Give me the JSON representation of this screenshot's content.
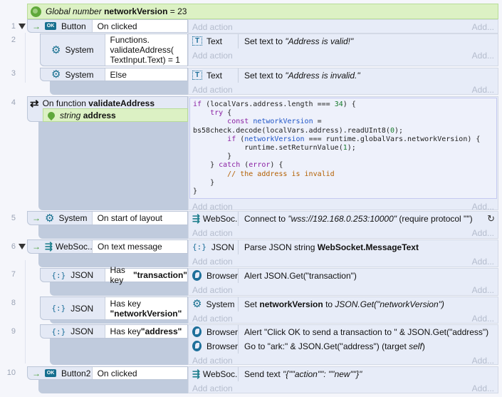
{
  "global_var": {
    "type_label": "Global number",
    "name": "networkVersion",
    "value_text": "= 23"
  },
  "common": {
    "add_action": "Add action",
    "add_more": "Add..."
  },
  "events": [
    {
      "line": "1",
      "object": "Button",
      "condition": "On clicked",
      "actions": []
    },
    {
      "line": "2",
      "object": "System",
      "condition": "Functions. validateAddress( TextInput.Text) = 1",
      "actions": [
        {
          "object": "Text",
          "text_pre": "Set text to ",
          "text_italic": "\"Address is valid!\""
        }
      ]
    },
    {
      "line": "3",
      "object": "System",
      "condition": "Else",
      "actions": [
        {
          "object": "Text",
          "text_pre": "Set text to ",
          "text_italic": "\"Address is invalid.\""
        }
      ]
    },
    {
      "line": "4",
      "function_label": "On function",
      "function_name": "validateAddress",
      "param_type": "string",
      "param_name": "address",
      "code": [
        "if (localVars.address.length === 34) {",
        "    try {",
        "        const networkVersion =",
        "bs58check.decode(localVars.address).readUInt8(0);",
        "        if (networkVersion === runtime.globalVars.networkVersion) {",
        "            runtime.setReturnValue(1);",
        "        }",
        "    } catch (error) {",
        "        // the address is invalid",
        "    }",
        "}"
      ]
    },
    {
      "line": "5",
      "object": "System",
      "condition": "On start of layout",
      "actions": [
        {
          "object": "WebSoc...",
          "text_pre": "Connect to ",
          "text_italic": "\"wss://192.168.0.253:10000\"",
          "text_post": " (require protocol \"\")"
        }
      ]
    },
    {
      "line": "6",
      "object": "WebSoc...",
      "condition": "On text message",
      "actions": [
        {
          "object": "JSON",
          "text_pre": "Parse JSON string ",
          "text_bold": "WebSocket.MessageText"
        }
      ]
    },
    {
      "line": "7",
      "object": "JSON",
      "condition_pre": "Has key ",
      "condition_bold": "\"transaction\"",
      "actions": [
        {
          "object": "Browser",
          "text_pre": "Alert JSON.Get(\"transaction\")"
        }
      ]
    },
    {
      "line": "8",
      "object": "JSON",
      "condition_pre": "Has key",
      "condition_bold": "\"networkVersion\"",
      "actions": [
        {
          "object": "System",
          "text_pre": "Set ",
          "text_bold": "networkVersion",
          "text_mid": " to ",
          "text_italic": "JSON.Get(\"networkVersion\")"
        }
      ]
    },
    {
      "line": "9",
      "object": "JSON",
      "condition_pre": "Has key ",
      "condition_bold": "\"address\"",
      "actions": [
        {
          "object": "Browser",
          "text_pre": "Alert \"Click OK to send a transaction to \" & JSON.Get(\"address\")"
        },
        {
          "object": "Browser",
          "text_pre": "Go to \"ark:\" & JSON.Get(\"address\") (target ",
          "text_italic": "self",
          "text_post": ")"
        }
      ]
    },
    {
      "line": "10",
      "object": "Button2",
      "condition": "On clicked",
      "actions": [
        {
          "object": "WebSoc...",
          "text_pre": "Send text ",
          "text_italic": "\"{\"\"action\"\": \"\"new\"\"}\""
        }
      ]
    }
  ],
  "colors": {
    "global_bg": "#dcf1c4",
    "icon_teal": "#166f8f",
    "action_bg": "#e7ecf8",
    "event_block": "#c0cbdd"
  }
}
